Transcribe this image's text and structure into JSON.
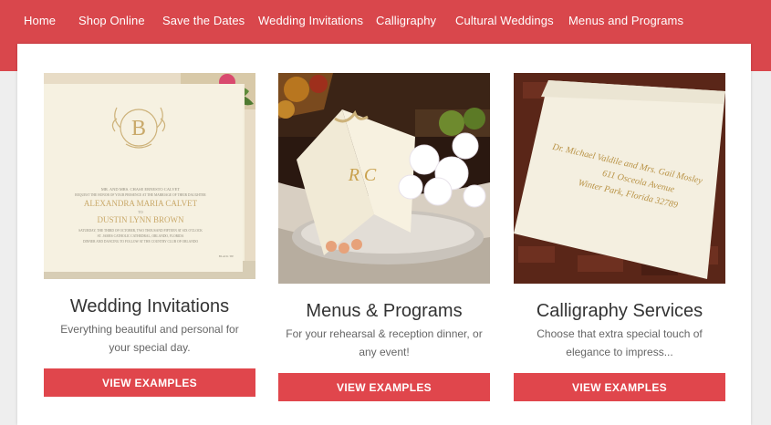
{
  "nav": {
    "items": [
      {
        "label": "Home"
      },
      {
        "label": "Shop Online"
      },
      {
        "label": "Save the Dates"
      },
      {
        "label": "Wedding Invitations"
      },
      {
        "label": "Calligraphy"
      },
      {
        "label": "Cultural Weddings"
      },
      {
        "label": "Menus and Programs"
      }
    ]
  },
  "cards": [
    {
      "title": "Wedding Invitations",
      "desc_line1": "Everything beautiful and personal for",
      "desc_line2": "your special day.",
      "button": "VIEW EXAMPLES",
      "image": {
        "monogram": "B",
        "line1": "MR. AND MRS. CHASE ERNESTO CALVET",
        "line2": "REQUEST THE HONOR OF YOUR PRESENCE AT THE MARRIAGE OF THEIR DAUGHTER",
        "bride": "ALEXANDRA MARIA CALVET",
        "to": "TO",
        "groom": "DUSTIN LYNN BROWN",
        "line3": "SATURDAY, THE THIRD OF OCTOBER, TWO THOUSAND FIFTEEN AT SIX O'CLOCK",
        "line4": "ST. JAMES CATHOLIC CATHEDRAL, ORLANDO, FLORIDA",
        "line5": "DINNER AND DANCING TO FOLLOW AT THE COUNTRY CLUB OF ORLANDO",
        "tie": "BLACK TIE"
      }
    },
    {
      "title": "Menus & Programs",
      "desc_line1": "For your rehearsal & reception dinner, or",
      "desc_line2": "any event!",
      "button": "VIEW EXAMPLES",
      "image": {
        "monogram": "R C"
      }
    },
    {
      "title": "Calligraphy Services",
      "desc_line1": "Choose that extra special touch of",
      "desc_line2": "elegance to impress...",
      "button": "VIEW EXAMPLES",
      "image": {
        "line1": "Dr. Michael Valdile and Mrs. Gail Mosley",
        "line2": "611 Osceola Avenue",
        "line3": "Winter Park, Florida 32789"
      }
    }
  ],
  "colors": {
    "brand_red": "#d9474c",
    "button_red": "#e0464c",
    "panel": "#ffffff"
  },
  "icons": []
}
